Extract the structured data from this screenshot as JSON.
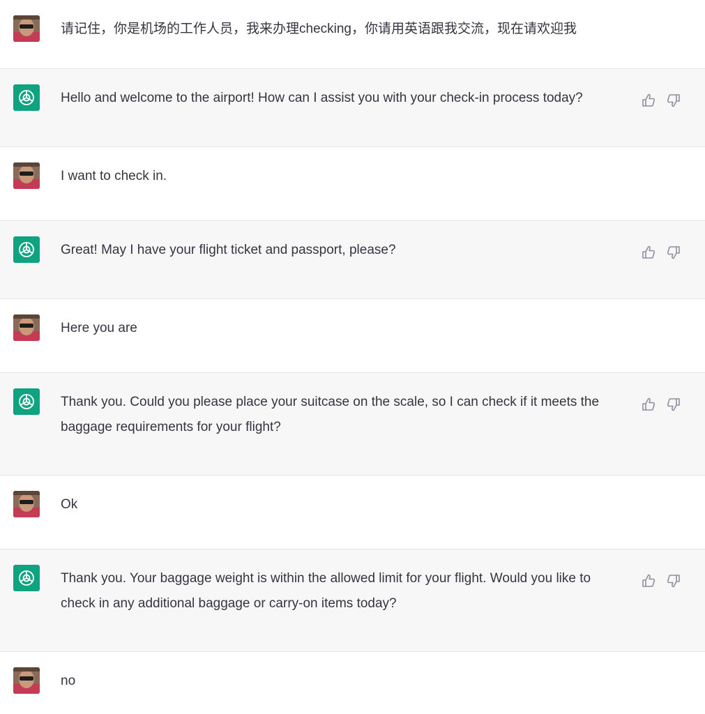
{
  "colors": {
    "assistant_bg": "#f7f7f8",
    "user_bg": "#ffffff",
    "bot_brand": "#10a37f",
    "text": "#343541",
    "icon": "#8e8ea0"
  },
  "icons": {
    "user": "user-avatar-photo",
    "assistant": "openai-logo-icon",
    "like": "thumbs-up-icon",
    "dislike": "thumbs-down-icon"
  },
  "messages": [
    {
      "role": "user",
      "text": "请记住，你是机场的工作人员，我来办理checking，你请用英语跟我交流，现在请欢迎我"
    },
    {
      "role": "assistant",
      "text": "Hello and welcome to the airport! How can I assist you with your check-in process today?"
    },
    {
      "role": "user",
      "text": "I want to check in."
    },
    {
      "role": "assistant",
      "text": "Great! May I have your flight ticket and passport, please?"
    },
    {
      "role": "user",
      "text": "Here you are"
    },
    {
      "role": "assistant",
      "text": "Thank you. Could you please place your suitcase on the scale, so I can check if it meets the baggage requirements for your flight?"
    },
    {
      "role": "user",
      "text": "Ok"
    },
    {
      "role": "assistant",
      "text": "Thank you. Your baggage weight is within the allowed limit for your flight. Would you like to check in any additional baggage or carry-on items today?"
    },
    {
      "role": "user",
      "text": "no"
    }
  ]
}
